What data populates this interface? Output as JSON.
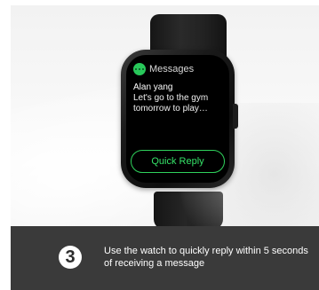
{
  "watch": {
    "app_name": "Messages",
    "app_icon": "chat-bubble-icon",
    "sender": "Alan yang",
    "message_preview": "Let's go to the gym tomorrow to play…",
    "reply_button_label": "Quick Reply"
  },
  "caption": {
    "step_number": "3",
    "text": "Use the watch to quickly reply within 5 seconds of receiving a message"
  },
  "colors": {
    "accent_green": "#2fd25c",
    "caption_bg": "#3a3a3a"
  }
}
